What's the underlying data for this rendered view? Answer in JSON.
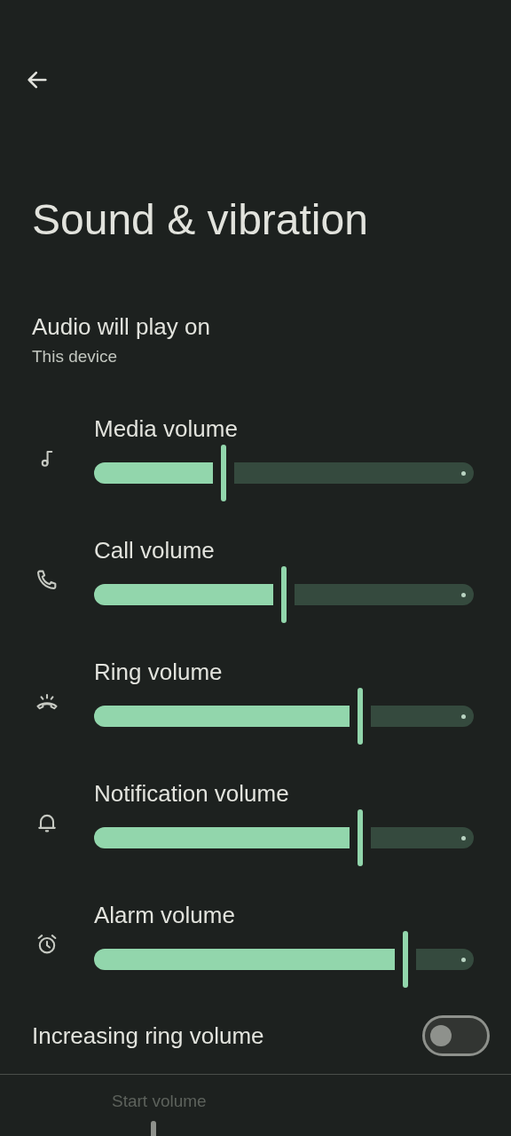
{
  "title": "Sound & vibration",
  "output": {
    "label": "Audio will play on",
    "value": "This device"
  },
  "volumes": [
    {
      "kind": "media",
      "label": "Media volume",
      "level": 0.34
    },
    {
      "kind": "call",
      "label": "Call volume",
      "level": 0.5
    },
    {
      "kind": "ring",
      "label": "Ring volume",
      "level": 0.7
    },
    {
      "kind": "notification",
      "label": "Notification volume",
      "level": 0.7
    },
    {
      "kind": "alarm",
      "label": "Alarm volume",
      "level": 0.82
    }
  ],
  "increasing_ring": {
    "label": "Increasing ring volume",
    "on": false
  },
  "start_volume": {
    "label": "Start volume",
    "disabled": true
  }
}
